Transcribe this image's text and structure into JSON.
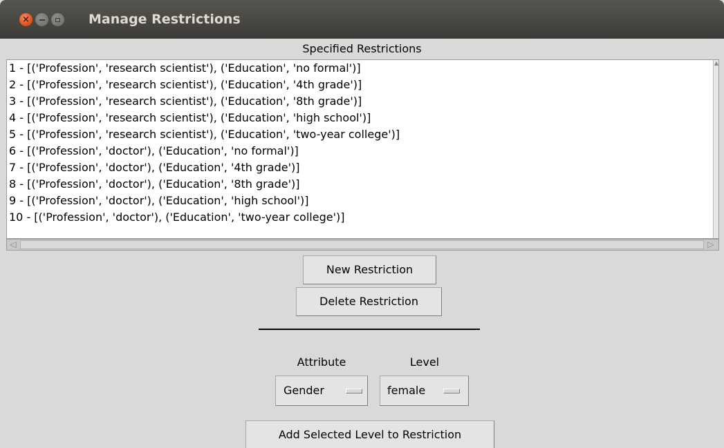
{
  "window": {
    "title": "Manage Restrictions",
    "controls": {
      "close": "×",
      "minimize": "–",
      "maximize": "□"
    }
  },
  "section_label": "Specified Restrictions",
  "restrictions": [
    "1 - [('Profession', 'research scientist'), ('Education', 'no formal')]",
    "2 - [('Profession', 'research scientist'), ('Education', '4th grade')]",
    "3 - [('Profession', 'research scientist'), ('Education', '8th grade')]",
    "4 - [('Profession', 'research scientist'), ('Education', 'high school')]",
    "5 - [('Profession', 'research scientist'), ('Education', 'two-year college')]",
    "6 - [('Profession', 'doctor'), ('Education', 'no formal')]",
    "7 - [('Profession', 'doctor'), ('Education', '4th grade')]",
    "8 - [('Profession', 'doctor'), ('Education', '8th grade')]",
    "9 - [('Profession', 'doctor'), ('Education', 'high school')]",
    "10 - [('Profession', 'doctor'), ('Education', 'two-year college')]"
  ],
  "buttons": {
    "new_restriction": "New Restriction",
    "delete_restriction": "Delete Restriction",
    "add_level": "Add Selected Level to Restriction"
  },
  "attribute": {
    "label": "Attribute",
    "selected": "Gender"
  },
  "level": {
    "label": "Level",
    "selected": "female"
  },
  "colors": {
    "titlebar": "#3c3b37",
    "close_button": "#e2531f",
    "background": "#d9d9d9"
  }
}
